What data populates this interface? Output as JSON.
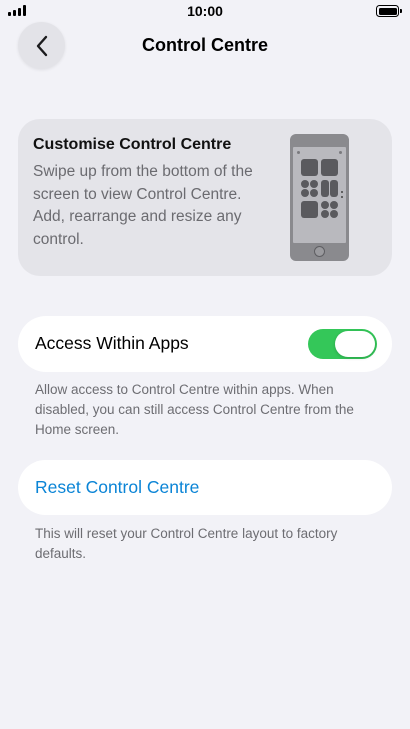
{
  "status_bar": {
    "time": "10:00",
    "signal_bars": 4,
    "battery_level": 1.0
  },
  "nav": {
    "title": "Control Centre",
    "back_icon": "chevron-left-icon"
  },
  "info_card": {
    "title": "Customise Control Centre",
    "description": "Swipe up from the bottom of the screen to view Control Centre. Add, rearrange and resize any control.",
    "illustration_icon": "phone-control-centre-icon"
  },
  "access_within_apps": {
    "label": "Access Within Apps",
    "enabled": true,
    "toggle_color": "#34c759",
    "footnote": "Allow access to Control Centre within apps. When disabled, you can still access Control Centre from the Home screen."
  },
  "reset": {
    "label": "Reset Control Centre",
    "link_color": "#0a84d6",
    "footnote": "This will reset your Control Centre layout to factory defaults."
  }
}
